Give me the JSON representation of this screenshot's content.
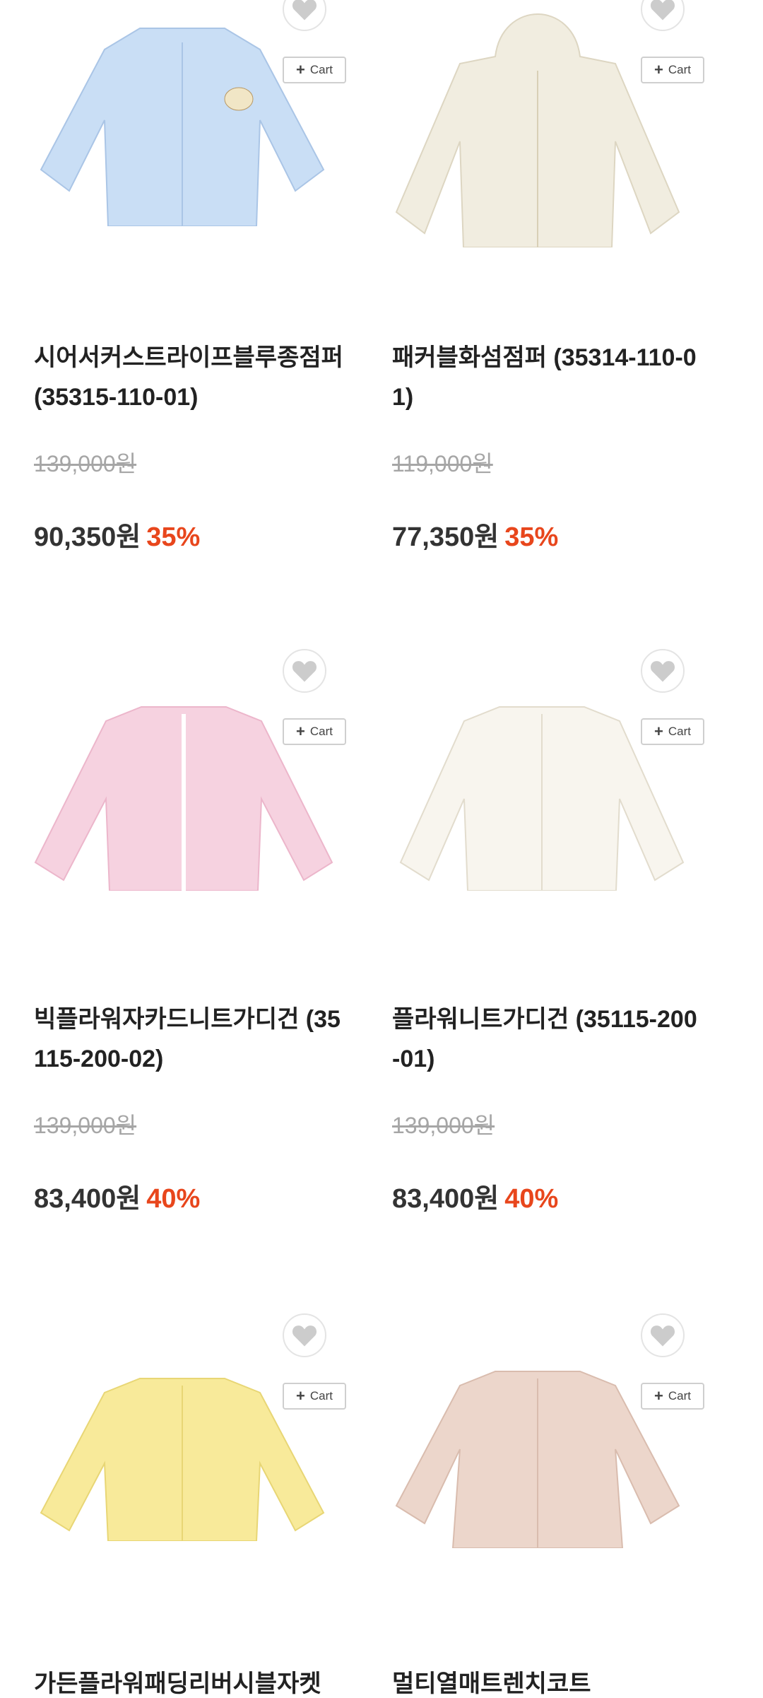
{
  "cart_label": "Cart",
  "products": [
    {
      "name": "시어서커스트라이프블루종점퍼 (35315-110-01)",
      "original_price": "139,000원",
      "sale_price": "90,350원",
      "discount": "35%",
      "color": "#c9def5"
    },
    {
      "name": "패커블화섬점퍼 (35314-110-01)",
      "original_price": "119,000원",
      "sale_price": "77,350원",
      "discount": "35%",
      "color": "#f1ede0"
    },
    {
      "name": "빅플라워자카드니트가디건 (35115-200-02)",
      "original_price": "139,000원",
      "sale_price": "83,400원",
      "discount": "40%",
      "color": "#f6d2e0"
    },
    {
      "name": "플라워니트가디건 (35115-200-01)",
      "original_price": "139,000원",
      "sale_price": "83,400원",
      "discount": "40%",
      "color": "#f8f5ee"
    },
    {
      "name": "가든플라워패딩리버시블자켓",
      "original_price": "",
      "sale_price": "",
      "discount": "",
      "color": "#f8ea9a"
    },
    {
      "name": "멀티열매트렌치코트",
      "original_price": "",
      "sale_price": "",
      "discount": "",
      "color": "#ecd6cb"
    }
  ]
}
